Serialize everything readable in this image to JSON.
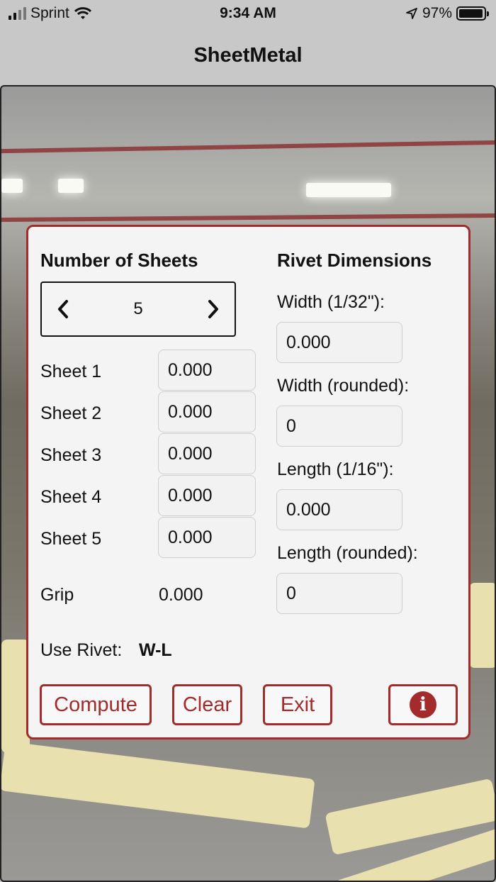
{
  "status_bar": {
    "carrier": "Sprint",
    "time": "9:34 AM",
    "battery": "97%",
    "battery_level": 0.97
  },
  "nav": {
    "title": "SheetMetal"
  },
  "sheets_section": {
    "heading": "Number of Sheets",
    "count": "5",
    "sheets": [
      {
        "label": "Sheet 1",
        "value": "0.000"
      },
      {
        "label": "Sheet 2",
        "value": "0.000"
      },
      {
        "label": "Sheet 3",
        "value": "0.000"
      },
      {
        "label": "Sheet 4",
        "value": "0.000"
      },
      {
        "label": "Sheet 5",
        "value": "0.000"
      }
    ],
    "grip_label": "Grip",
    "grip_value": "0.000",
    "use_rivet_label": "Use Rivet:",
    "use_rivet_value": "W-L"
  },
  "rivet_section": {
    "heading": "Rivet Dimensions",
    "width_label": "Width (1/32\"):",
    "width_value": "0.000",
    "width_rounded_label": "Width (rounded):",
    "width_rounded_value": "0",
    "length_label": "Length (1/16\"):",
    "length_value": "0.000",
    "length_rounded_label": "Length (rounded):",
    "length_rounded_value": "0"
  },
  "buttons": {
    "compute": "Compute",
    "clear": "Clear",
    "exit": "Exit",
    "info_icon": "info-icon"
  },
  "colors": {
    "accent": "#a32b2b",
    "panel": "#f4f4f4"
  }
}
